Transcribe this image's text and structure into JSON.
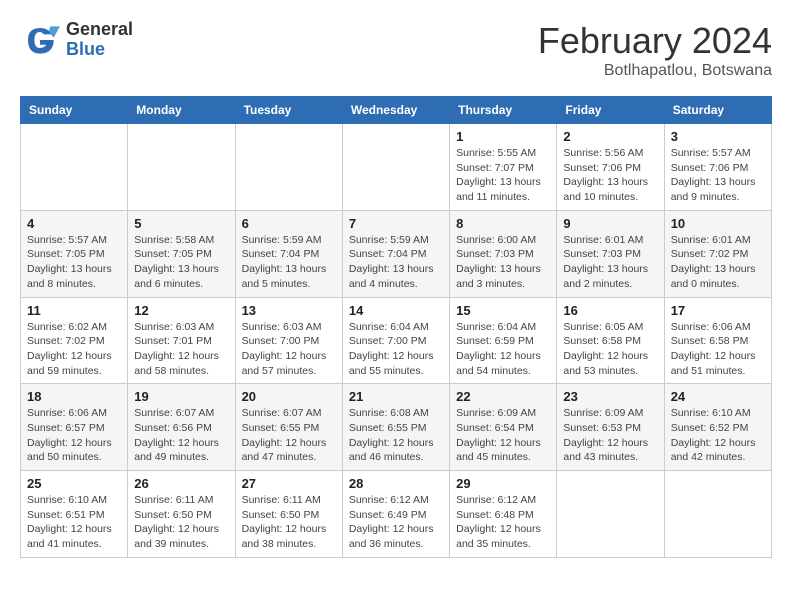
{
  "header": {
    "logo": {
      "general": "General",
      "blue": "Blue"
    },
    "title": "February 2024",
    "location": "Botlhapatlou, Botswana"
  },
  "days_of_week": [
    "Sunday",
    "Monday",
    "Tuesday",
    "Wednesday",
    "Thursday",
    "Friday",
    "Saturday"
  ],
  "weeks": [
    [
      {
        "day": "",
        "info": ""
      },
      {
        "day": "",
        "info": ""
      },
      {
        "day": "",
        "info": ""
      },
      {
        "day": "",
        "info": ""
      },
      {
        "day": "1",
        "info": "Sunrise: 5:55 AM\nSunset: 7:07 PM\nDaylight: 13 hours\nand 11 minutes."
      },
      {
        "day": "2",
        "info": "Sunrise: 5:56 AM\nSunset: 7:06 PM\nDaylight: 13 hours\nand 10 minutes."
      },
      {
        "day": "3",
        "info": "Sunrise: 5:57 AM\nSunset: 7:06 PM\nDaylight: 13 hours\nand 9 minutes."
      }
    ],
    [
      {
        "day": "4",
        "info": "Sunrise: 5:57 AM\nSunset: 7:05 PM\nDaylight: 13 hours\nand 8 minutes."
      },
      {
        "day": "5",
        "info": "Sunrise: 5:58 AM\nSunset: 7:05 PM\nDaylight: 13 hours\nand 6 minutes."
      },
      {
        "day": "6",
        "info": "Sunrise: 5:59 AM\nSunset: 7:04 PM\nDaylight: 13 hours\nand 5 minutes."
      },
      {
        "day": "7",
        "info": "Sunrise: 5:59 AM\nSunset: 7:04 PM\nDaylight: 13 hours\nand 4 minutes."
      },
      {
        "day": "8",
        "info": "Sunrise: 6:00 AM\nSunset: 7:03 PM\nDaylight: 13 hours\nand 3 minutes."
      },
      {
        "day": "9",
        "info": "Sunrise: 6:01 AM\nSunset: 7:03 PM\nDaylight: 13 hours\nand 2 minutes."
      },
      {
        "day": "10",
        "info": "Sunrise: 6:01 AM\nSunset: 7:02 PM\nDaylight: 13 hours\nand 0 minutes."
      }
    ],
    [
      {
        "day": "11",
        "info": "Sunrise: 6:02 AM\nSunset: 7:02 PM\nDaylight: 12 hours\nand 59 minutes."
      },
      {
        "day": "12",
        "info": "Sunrise: 6:03 AM\nSunset: 7:01 PM\nDaylight: 12 hours\nand 58 minutes."
      },
      {
        "day": "13",
        "info": "Sunrise: 6:03 AM\nSunset: 7:00 PM\nDaylight: 12 hours\nand 57 minutes."
      },
      {
        "day": "14",
        "info": "Sunrise: 6:04 AM\nSunset: 7:00 PM\nDaylight: 12 hours\nand 55 minutes."
      },
      {
        "day": "15",
        "info": "Sunrise: 6:04 AM\nSunset: 6:59 PM\nDaylight: 12 hours\nand 54 minutes."
      },
      {
        "day": "16",
        "info": "Sunrise: 6:05 AM\nSunset: 6:58 PM\nDaylight: 12 hours\nand 53 minutes."
      },
      {
        "day": "17",
        "info": "Sunrise: 6:06 AM\nSunset: 6:58 PM\nDaylight: 12 hours\nand 51 minutes."
      }
    ],
    [
      {
        "day": "18",
        "info": "Sunrise: 6:06 AM\nSunset: 6:57 PM\nDaylight: 12 hours\nand 50 minutes."
      },
      {
        "day": "19",
        "info": "Sunrise: 6:07 AM\nSunset: 6:56 PM\nDaylight: 12 hours\nand 49 minutes."
      },
      {
        "day": "20",
        "info": "Sunrise: 6:07 AM\nSunset: 6:55 PM\nDaylight: 12 hours\nand 47 minutes."
      },
      {
        "day": "21",
        "info": "Sunrise: 6:08 AM\nSunset: 6:55 PM\nDaylight: 12 hours\nand 46 minutes."
      },
      {
        "day": "22",
        "info": "Sunrise: 6:09 AM\nSunset: 6:54 PM\nDaylight: 12 hours\nand 45 minutes."
      },
      {
        "day": "23",
        "info": "Sunrise: 6:09 AM\nSunset: 6:53 PM\nDaylight: 12 hours\nand 43 minutes."
      },
      {
        "day": "24",
        "info": "Sunrise: 6:10 AM\nSunset: 6:52 PM\nDaylight: 12 hours\nand 42 minutes."
      }
    ],
    [
      {
        "day": "25",
        "info": "Sunrise: 6:10 AM\nSunset: 6:51 PM\nDaylight: 12 hours\nand 41 minutes."
      },
      {
        "day": "26",
        "info": "Sunrise: 6:11 AM\nSunset: 6:50 PM\nDaylight: 12 hours\nand 39 minutes."
      },
      {
        "day": "27",
        "info": "Sunrise: 6:11 AM\nSunset: 6:50 PM\nDaylight: 12 hours\nand 38 minutes."
      },
      {
        "day": "28",
        "info": "Sunrise: 6:12 AM\nSunset: 6:49 PM\nDaylight: 12 hours\nand 36 minutes."
      },
      {
        "day": "29",
        "info": "Sunrise: 6:12 AM\nSunset: 6:48 PM\nDaylight: 12 hours\nand 35 minutes."
      },
      {
        "day": "",
        "info": ""
      },
      {
        "day": "",
        "info": ""
      }
    ]
  ]
}
